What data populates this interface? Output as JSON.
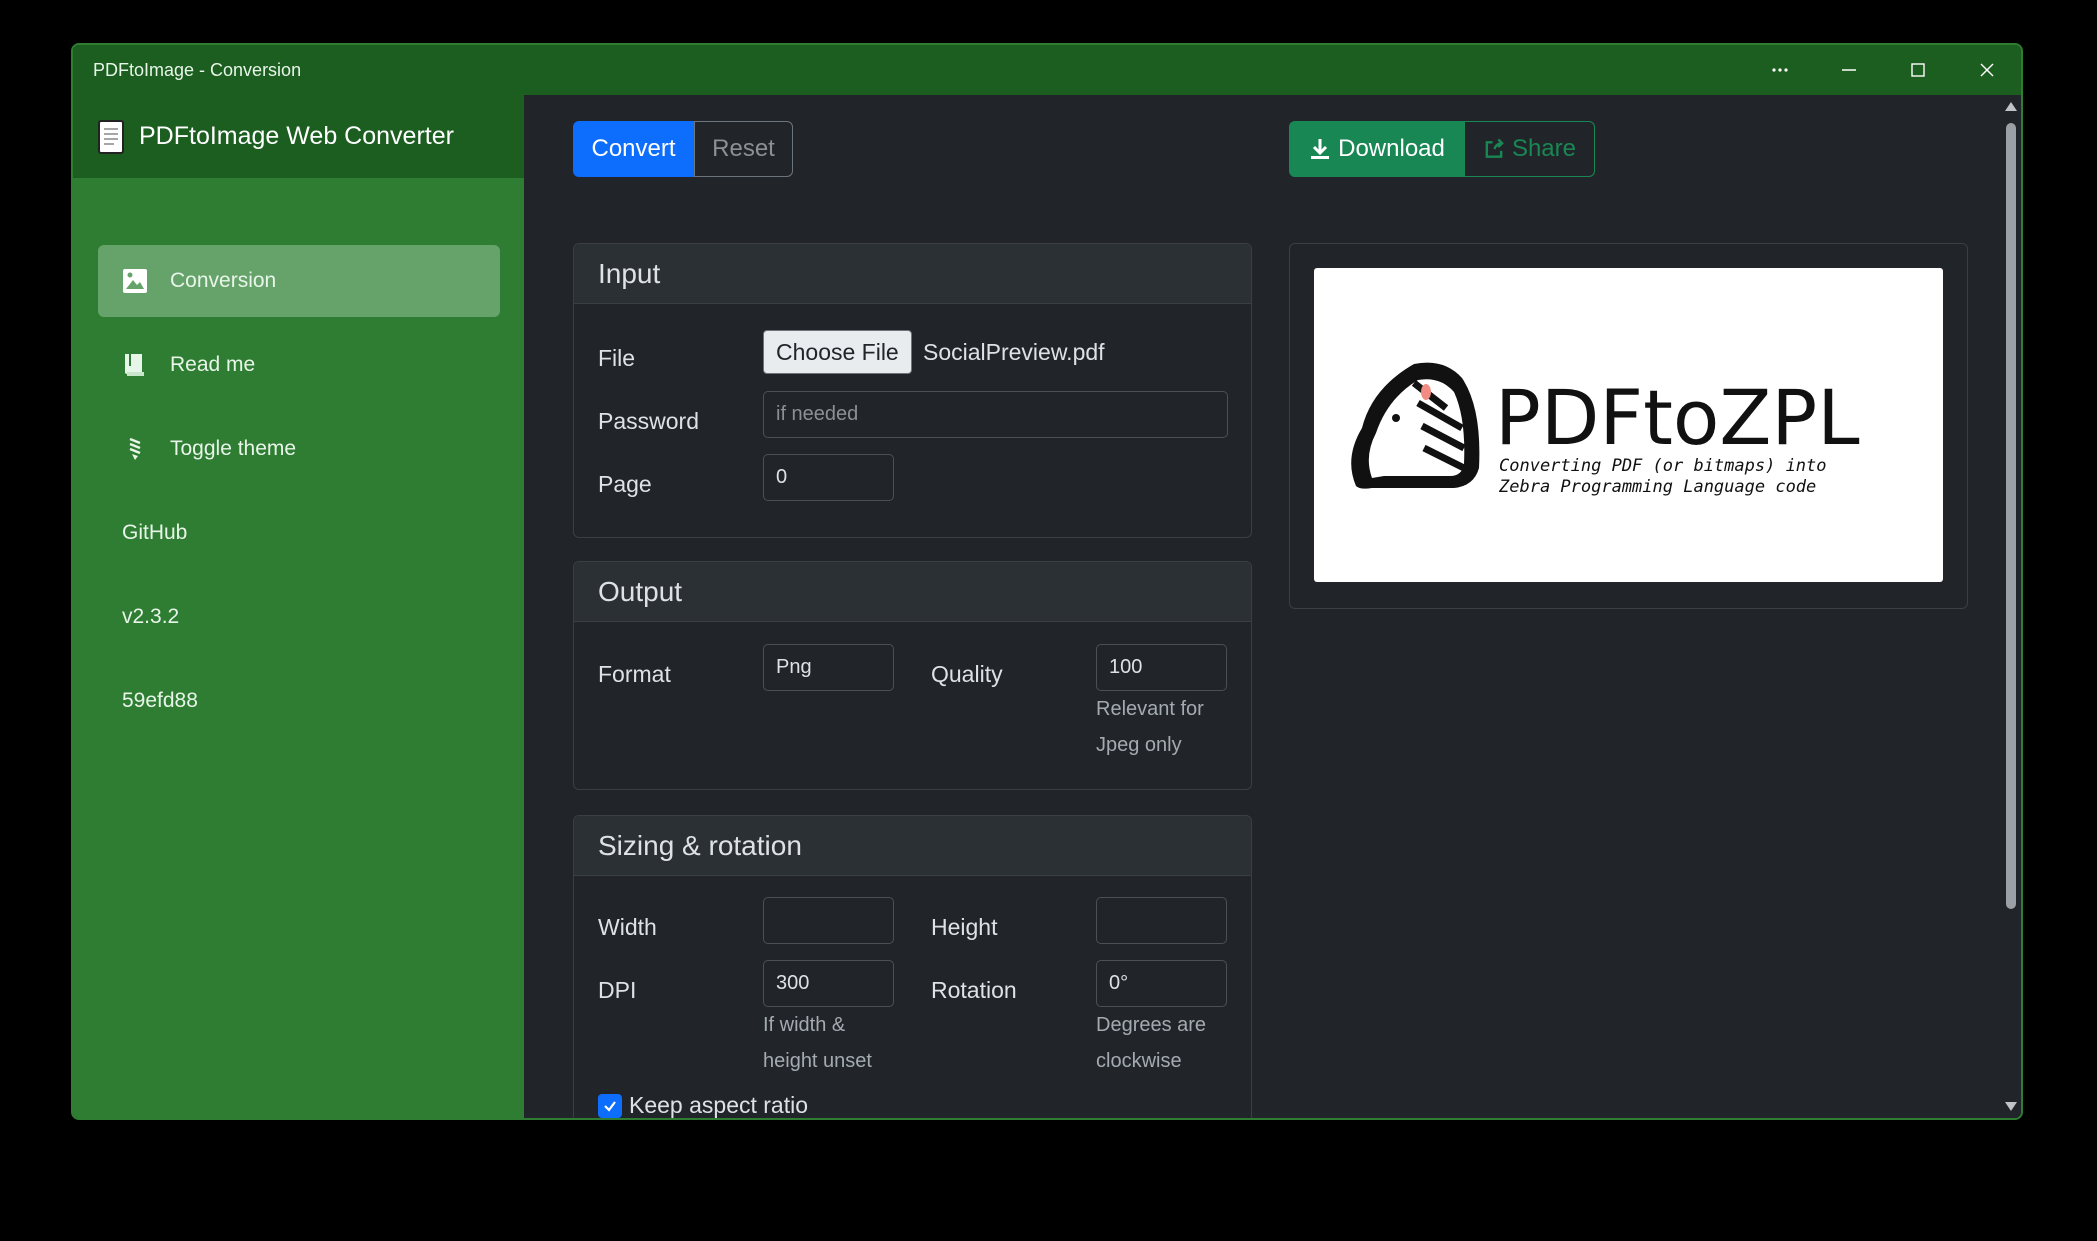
{
  "window": {
    "title": "PDFtoImage - Conversion"
  },
  "sidebar": {
    "brand": "PDFtoImage Web Converter",
    "items": [
      {
        "label": "Conversion",
        "icon": "image-icon",
        "active": true
      },
      {
        "label": "Read me",
        "icon": "book-icon"
      },
      {
        "label": "Toggle theme",
        "icon": "lightbulb-icon"
      },
      {
        "label": "GitHub"
      },
      {
        "label": "v2.3.2"
      },
      {
        "label": "59efd88"
      }
    ]
  },
  "toolbar": {
    "convert_label": "Convert",
    "reset_label": "Reset",
    "download_label": "Download",
    "share_label": "Share"
  },
  "input": {
    "header": "Input",
    "file_label": "File",
    "choose_file_label": "Choose File",
    "file_name": "SocialPreview.pdf",
    "password_label": "Password",
    "password_placeholder": "if needed",
    "page_label": "Page",
    "page_value": "0"
  },
  "output": {
    "header": "Output",
    "format_label": "Format",
    "format_value": "Png",
    "quality_label": "Quality",
    "quality_value": "100",
    "quality_hint_1": "Relevant for",
    "quality_hint_2": "Jpeg only"
  },
  "sizing": {
    "header": "Sizing & rotation",
    "width_label": "Width",
    "width_value": "",
    "height_label": "Height",
    "height_value": "",
    "dpi_label": "DPI",
    "dpi_value": "300",
    "dpi_hint_1": "If width &",
    "dpi_hint_2": "height unset",
    "rotation_label": "Rotation",
    "rotation_value": "0°",
    "rotation_hint_1": "Degrees are",
    "rotation_hint_2": "clockwise",
    "keep_aspect_label": "Keep aspect ratio",
    "keep_aspect_checked": true
  },
  "preview": {
    "title": "PDFtoZPL",
    "subtitle_1": "Converting PDF (or bitmaps) into",
    "subtitle_2": "Zebra Programming Language code"
  },
  "colors": {
    "sidebar": "#2e7d32",
    "titlebar": "#1b5e20",
    "primary": "#0d6efd",
    "success": "#198754"
  }
}
